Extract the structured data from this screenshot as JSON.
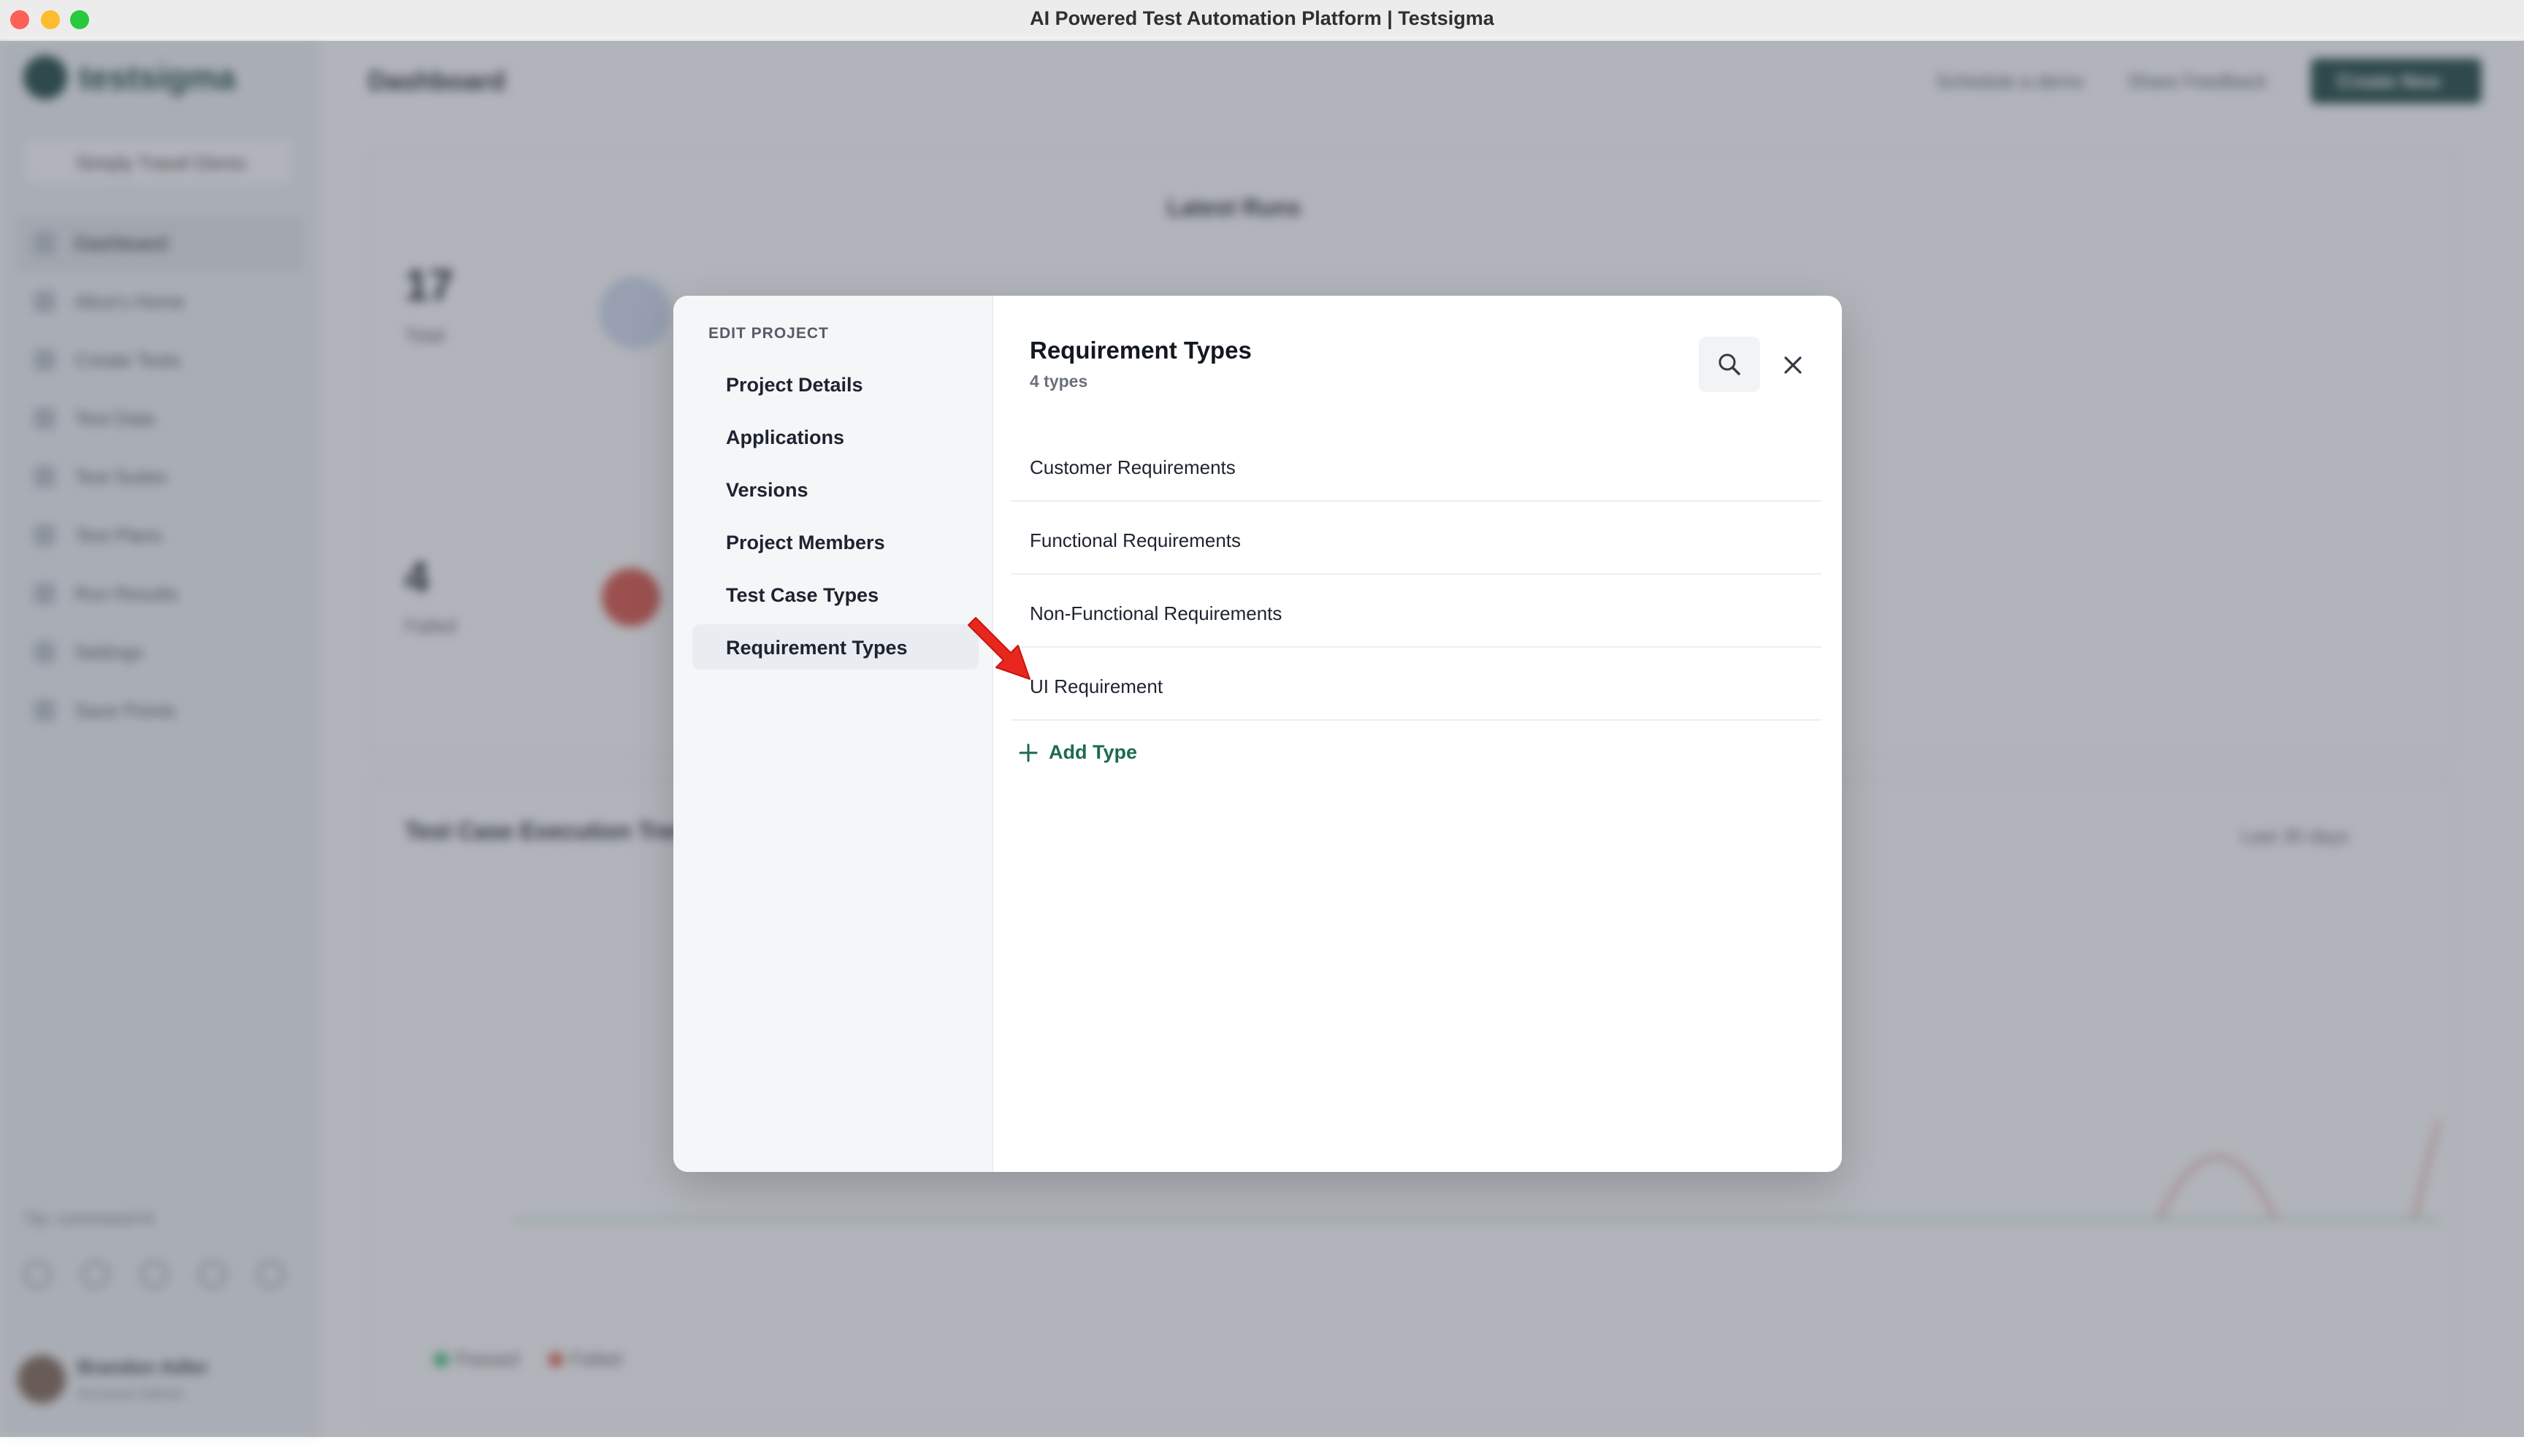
{
  "window": {
    "title": "AI Powered Test Automation Platform | Testsigma"
  },
  "background": {
    "brand": "testsigma",
    "project": "Simply Travel Demo",
    "nav": [
      "Dashboard",
      "Alice's Home",
      "Create Tests",
      "Test Data",
      "Test Suites",
      "Test Plans",
      "Run Results",
      "Settings",
      "Save Points"
    ],
    "command_hint": "Tip: command+K",
    "user_name": "Brandon Adler",
    "user_role": "Account Admin",
    "page_title": "Dashboard",
    "schedule_demo": "Schedule a demo",
    "share_feedback": "Share Feedback",
    "create_new": "Create New",
    "stats": [
      {
        "value": "17",
        "label": "Total"
      },
      {
        "value": "4",
        "label": "Failed"
      }
    ],
    "latest_runs": "Latest Runs",
    "trend_title": "Test Case Execution Trend",
    "trend_range": "Last 30 days",
    "legend_passed": "Passed",
    "legend_failed": "Failed"
  },
  "modal": {
    "side_heading": "EDIT PROJECT",
    "side_items": [
      "Project Details",
      "Applications",
      "Versions",
      "Project Members",
      "Test Case Types",
      "Requirement Types"
    ],
    "active_item": "Requirement Types",
    "title": "Requirement Types",
    "subtitle": "4 types",
    "types": [
      "Customer Requirements",
      "Functional Requirements",
      "Non-Functional Requirements",
      "UI Requirement"
    ],
    "add_type": "Add Type",
    "icons": {
      "search": "search-icon",
      "close": "close-icon",
      "add": "plus-icon"
    },
    "colors": {
      "accent": "#1d6b4c",
      "annotation": "#e8281f"
    }
  }
}
